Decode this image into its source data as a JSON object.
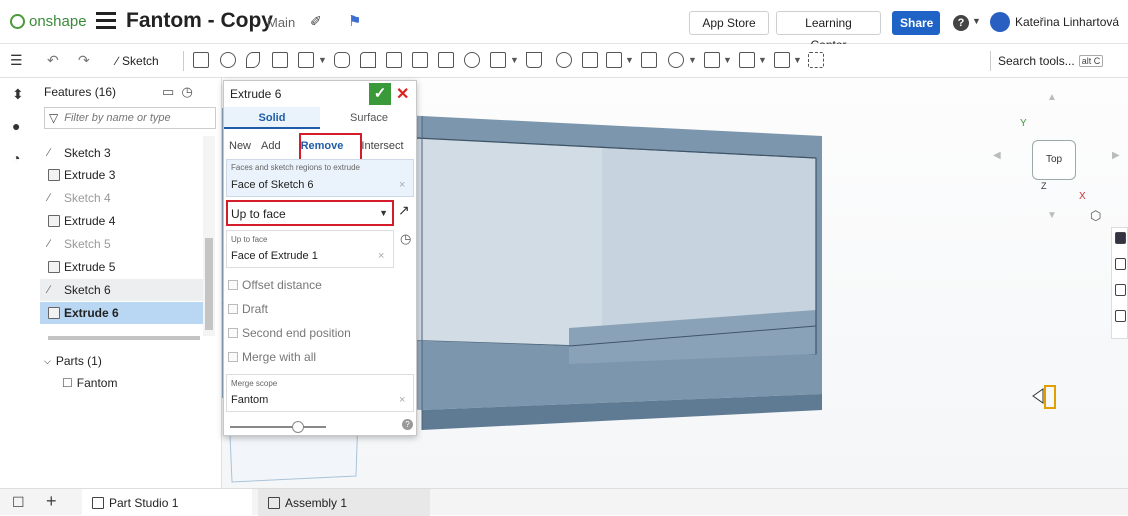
{
  "header": {
    "brand": "onshape",
    "doc_title": "Fantom - Copy",
    "workspace": "Main",
    "app_store": "App Store",
    "learning_center": "Learning Center",
    "share": "Share",
    "user_name": "Kateřina Linhartová"
  },
  "toolbar": {
    "sketch_label": "Sketch",
    "search_label": "Search tools...",
    "search_shortcut": "alt C"
  },
  "features": {
    "header": "Features (16)",
    "filter_placeholder": "Filter by name or type",
    "items": [
      {
        "label": "Sketch 3",
        "icon": "sketch-icon",
        "state": "normal"
      },
      {
        "label": "Extrude 3",
        "icon": "extrude-icon",
        "state": "normal"
      },
      {
        "label": "Sketch 4",
        "icon": "sketch-icon",
        "state": "dim"
      },
      {
        "label": "Extrude 4",
        "icon": "extrude-icon",
        "state": "normal"
      },
      {
        "label": "Sketch 5",
        "icon": "sketch-icon",
        "state": "dim"
      },
      {
        "label": "Extrude 5",
        "icon": "extrude-icon",
        "state": "normal"
      },
      {
        "label": "Sketch 6",
        "icon": "sketch-icon",
        "state": "hover"
      },
      {
        "label": "Extrude 6",
        "icon": "extrude-icon",
        "state": "selected"
      }
    ],
    "parts_header": "Parts (1)",
    "part_name": "Fantom"
  },
  "dialog": {
    "title": "Extrude 6",
    "type_tabs": [
      "Solid",
      "Surface"
    ],
    "operations": [
      "New",
      "Add",
      "Remove",
      "Intersect"
    ],
    "faces_label": "Faces and sketch regions to extrude",
    "faces_value": "Face of Sketch 6",
    "end_type": "Up to face",
    "upto_label": "Up to face",
    "upto_value": "Face of Extrude 1",
    "checkboxes": [
      "Offset distance",
      "Draft",
      "Second end position",
      "Merge with all"
    ],
    "scope_label": "Merge scope",
    "scope_value": "Fantom"
  },
  "viewport": {
    "view_label": "Top",
    "axis_y": "Y",
    "axis_z": "Z",
    "axis_x": "X"
  },
  "tabs": {
    "part_studio": "Part Studio 1",
    "assembly": "Assembly 1"
  },
  "colors": {
    "accent": "#1f63c7",
    "highlight": "#d51c2b",
    "selected_row": "#b9d7f2",
    "model": "#7c96ad",
    "ok": "#3a9a3a"
  }
}
